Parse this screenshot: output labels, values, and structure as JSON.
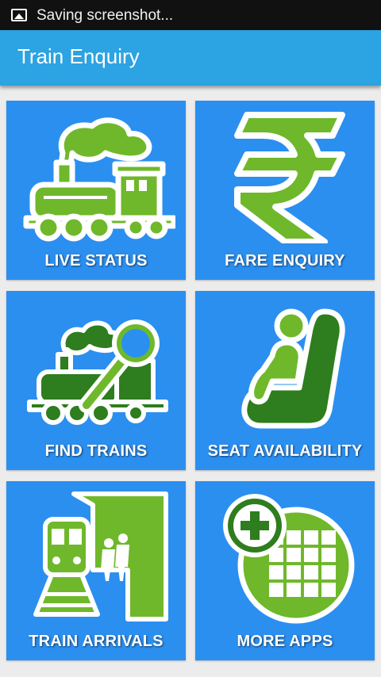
{
  "status_bar": {
    "notification_text": "Saving screenshot..."
  },
  "app_bar": {
    "title": "Train Enquiry"
  },
  "tiles": [
    {
      "label": "LIVE  STATUS",
      "icon": "steam-locomotive-icon"
    },
    {
      "label": "FARE ENQUIRY",
      "icon": "rupee-icon"
    },
    {
      "label": "FIND TRAINS",
      "icon": "train-search-icon"
    },
    {
      "label": "SEAT AVAILABILITY",
      "icon": "seat-icon"
    },
    {
      "label": "TRAIN ARRIVALS",
      "icon": "platform-arrival-icon"
    },
    {
      "label": "MORE APPS",
      "icon": "apps-grid-plus-icon"
    }
  ],
  "colors": {
    "app_bar": "#2ca3e2",
    "tile_background": "#2b8ff0",
    "icon_light_green": "#6fb82b",
    "icon_dark_green": "#2e7d1e",
    "status_bar": "#111111"
  }
}
